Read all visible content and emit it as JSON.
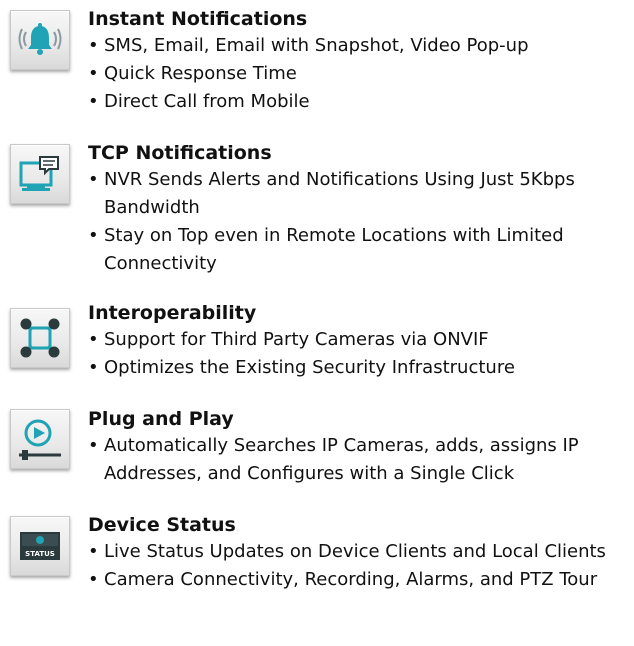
{
  "colors": {
    "accent": "#1fa3b5",
    "dark": "#2b3a3d",
    "text": "#111111"
  },
  "features": [
    {
      "icon": "bell-icon",
      "title": "Instant Notifications",
      "bullets": [
        "SMS, Email, Email with Snapshot, Video Pop-up",
        "Quick Response Time",
        "Direct Call from Mobile"
      ]
    },
    {
      "icon": "monitor-chat-icon",
      "title": "TCP Notifications",
      "bullets": [
        "NVR Sends Alerts and Notifications Using Just 5Kbps Bandwidth",
        "Stay on Top even in Remote Locations with Limited Connectivity"
      ]
    },
    {
      "icon": "network-nodes-icon",
      "title": "Interoperability",
      "bullets": [
        "Support for Third Party Cameras via ONVIF",
        "Optimizes the Existing Security Infrastructure"
      ]
    },
    {
      "icon": "play-slider-icon",
      "title": "Plug and Play",
      "bullets": [
        "Automatically Searches IP Cameras, adds, assigns IP Addresses, and Configures with a Single Click"
      ]
    },
    {
      "icon": "status-device-icon",
      "icon_label": "STATUS",
      "title": "Device Status",
      "bullets": [
        "Live Status Updates on Device Clients and Local Clients",
        "Camera Connectivity, Recording, Alarms, and PTZ Tour"
      ]
    }
  ]
}
